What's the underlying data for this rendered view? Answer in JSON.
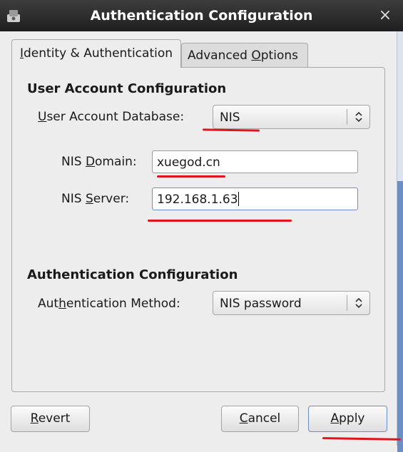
{
  "window": {
    "title": "Authentication Configuration",
    "close_glyph": "×",
    "icon": "app-icon"
  },
  "tabs": [
    {
      "pre": "",
      "mnemonic": "I",
      "post": "dentity & Authentication",
      "active": true
    },
    {
      "pre": "Advanced ",
      "mnemonic": "O",
      "post": "ptions",
      "active": false
    }
  ],
  "user_account": {
    "heading": "User Account Configuration",
    "db_label": {
      "pre": "",
      "mnemonic": "U",
      "post": "ser Account Database:"
    },
    "db_value": "NIS",
    "nis_domain_label": {
      "pre": "NIS ",
      "mnemonic": "D",
      "post": "omain:"
    },
    "nis_domain_value": "xuegod.cn",
    "nis_server_label": {
      "pre": "NIS ",
      "mnemonic": "S",
      "post": "erver:"
    },
    "nis_server_value": "192.168.1.63"
  },
  "authentication": {
    "heading": "Authentication Configuration",
    "method_label": {
      "pre": "Aut",
      "mnemonic": "h",
      "post": "entication Method:"
    },
    "method_value": "NIS password"
  },
  "buttons": {
    "revert": {
      "pre": "",
      "mnemonic": "R",
      "post": "evert"
    },
    "cancel": {
      "pre": "",
      "mnemonic": "C",
      "post": "ancel"
    },
    "apply": {
      "pre": "",
      "mnemonic": "A",
      "post": "pply"
    }
  },
  "colors": {
    "annotation": "#e0141c",
    "titlebar": "#2a2a2a",
    "focus": "#6a8ec8"
  }
}
